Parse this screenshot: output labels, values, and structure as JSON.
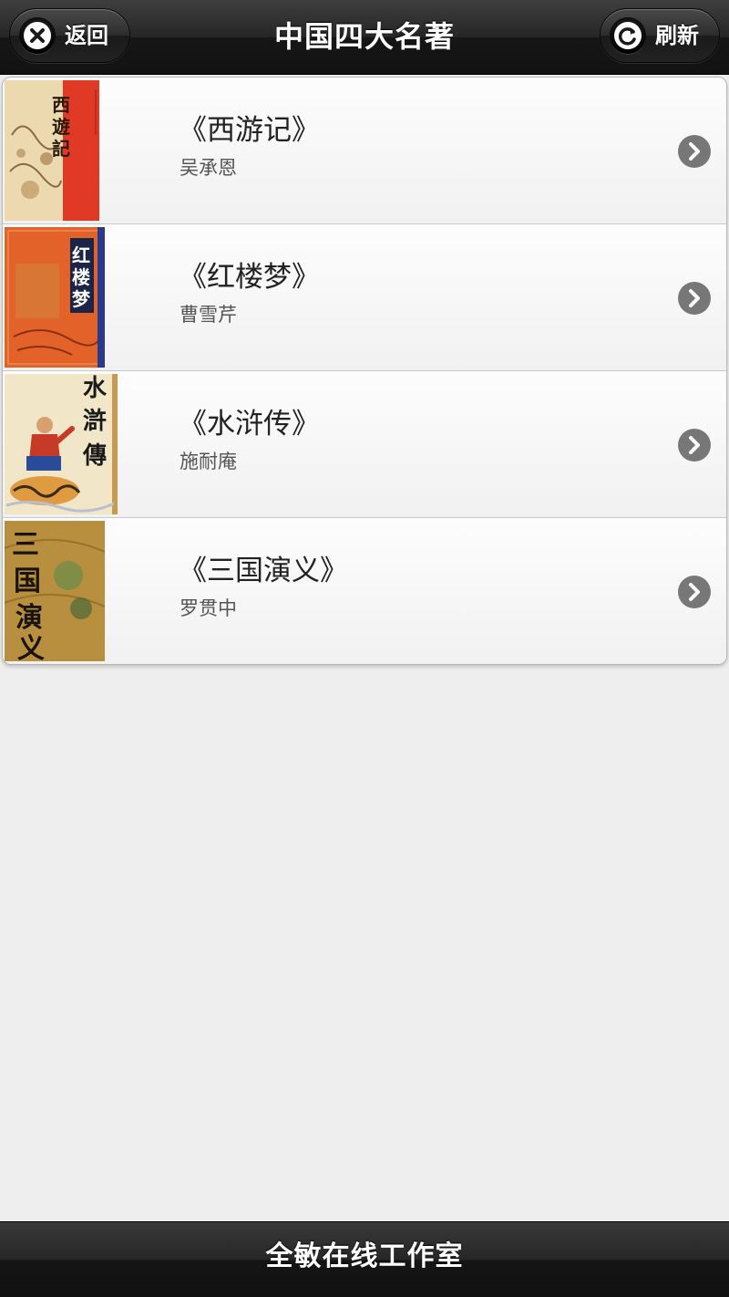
{
  "header": {
    "title": "中国四大名著",
    "back_label": "返回",
    "back_icon": "close-icon",
    "refresh_label": "刷新",
    "refresh_icon": "refresh-icon"
  },
  "books": [
    {
      "title": "《西游记》",
      "author": "吴承恩",
      "cover_text": "西遊記",
      "cover_icon": "book-cover-xiyouji"
    },
    {
      "title": "《红楼梦》",
      "author": "曹雪芹",
      "cover_text": "红楼梦",
      "cover_icon": "book-cover-hongloumeng"
    },
    {
      "title": "《水浒传》",
      "author": "施耐庵",
      "cover_text": "水滸傳",
      "cover_icon": "book-cover-shuihuzhuan"
    },
    {
      "title": "《三国演义》",
      "author": "罗贯中",
      "cover_text": "三国演义",
      "cover_icon": "book-cover-sanguoyanyi"
    }
  ],
  "footer": {
    "text": "全敏在线工作室"
  },
  "colors": {
    "header_bg": "#1e1e1e",
    "list_bg": "#f4f4f4",
    "page_bg": "#eeeeee",
    "arrow": "#777777"
  }
}
